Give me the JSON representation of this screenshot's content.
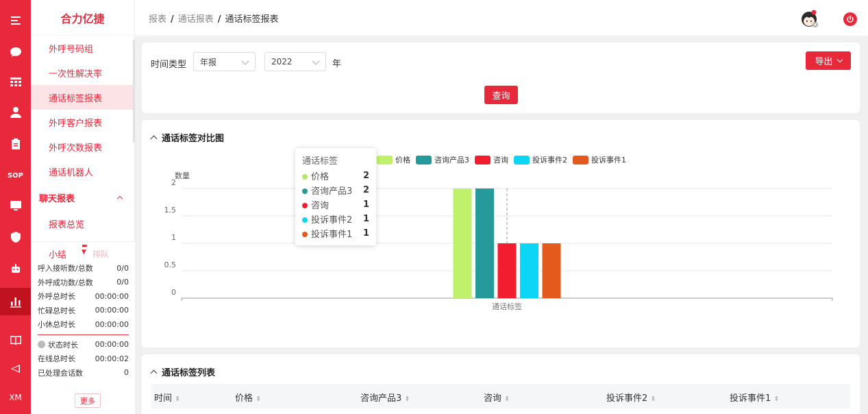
{
  "rail": {
    "sop_label": "SOP",
    "xm_label": "XM"
  },
  "sidebar": {
    "brand": "合力亿捷",
    "items": [
      {
        "label": "外呼号码组"
      },
      {
        "label": "一次性解决率"
      },
      {
        "label": "通话标签报表"
      },
      {
        "label": "外呼客户报表"
      },
      {
        "label": "外呼次数报表"
      },
      {
        "label": "通话机器人"
      }
    ],
    "group": {
      "label": "聊天报表"
    },
    "sub_items": [
      {
        "label": "报表总览"
      }
    ]
  },
  "stats": {
    "tabs": [
      "小结",
      "排队"
    ],
    "rows": [
      {
        "label": "呼入接听数/总数",
        "value": "0/0"
      },
      {
        "label": "外呼成功数/总数",
        "value": "0/0"
      },
      {
        "label": "外呼总时长",
        "value": "00:00:00"
      },
      {
        "label": "忙碌总时长",
        "value": "00:00:00"
      },
      {
        "label": "小休总时长",
        "value": "00:00:00"
      }
    ],
    "rows2": [
      {
        "label": "状态时长",
        "value": "00:00:00"
      },
      {
        "label": "在线总时长",
        "value": "00:00:02"
      },
      {
        "label": "已处理会话数",
        "value": "0"
      }
    ],
    "more_label": "更多"
  },
  "breadcrumb": {
    "items": [
      "报表",
      "通话报表",
      "通话标签报表"
    ]
  },
  "filter": {
    "time_type_label": "时间类型",
    "time_type_value": "年报",
    "year_value": "2022",
    "year_unit": "年",
    "query_label": "查询",
    "export_label": "导出"
  },
  "chart_section": {
    "title": "通话标签对比图"
  },
  "chart_data": {
    "type": "bar",
    "categories": [
      "通话标签"
    ],
    "series": [
      {
        "name": "价格",
        "values": [
          2
        ],
        "color": "#bff26a"
      },
      {
        "name": "咨询产品3",
        "values": [
          2
        ],
        "color": "#26999a"
      },
      {
        "name": "咨询",
        "values": [
          1
        ],
        "color": "#f21d2e"
      },
      {
        "name": "投诉事件2",
        "values": [
          1
        ],
        "color": "#0bd7f4"
      },
      {
        "name": "投诉事件1",
        "values": [
          1
        ],
        "color": "#e35b1c"
      }
    ],
    "ylabel": "数量",
    "yticks": [
      "0",
      "0.5",
      "1",
      "1.5",
      "2"
    ],
    "ylim": [
      0,
      2
    ],
    "legend_position": "top"
  },
  "tooltip": {
    "title": "通话标签",
    "rows": [
      {
        "name": "价格",
        "value": "2",
        "color": "#b5e86b"
      },
      {
        "name": "咨询产品3",
        "value": "2",
        "color": "#26999a"
      },
      {
        "name": "咨询",
        "value": "1",
        "color": "#f21d2e"
      },
      {
        "name": "投诉事件2",
        "value": "1",
        "color": "#0bd7f4"
      },
      {
        "name": "投诉事件1",
        "value": "1",
        "color": "#e35b1c"
      }
    ]
  },
  "table_section": {
    "title": "通话标签列表",
    "columns": [
      "时间",
      "价格",
      "咨询产品3",
      "咨询",
      "投诉事件2",
      "投诉事件1"
    ]
  },
  "colors": {
    "brand": "#e8293b"
  }
}
